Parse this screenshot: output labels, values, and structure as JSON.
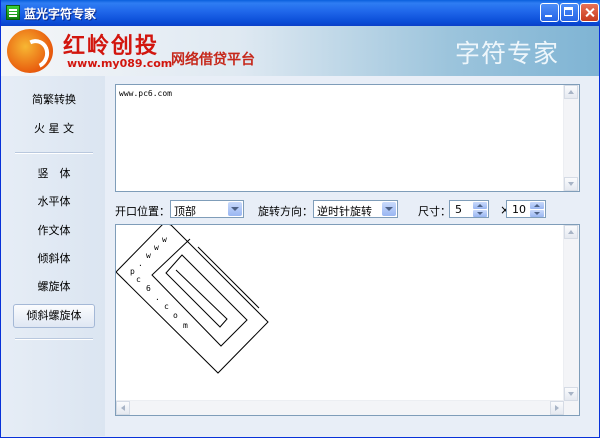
{
  "window": {
    "title": "蓝光字符专家"
  },
  "banner": {
    "brand": "红岭创投",
    "url": "www.my089.com",
    "slogan": "网络借贷平台",
    "product": "字符专家"
  },
  "sidebar": {
    "items": [
      {
        "label": "简繁转换"
      },
      {
        "label": "火 星 文"
      },
      {
        "label": "竖　体"
      },
      {
        "label": "水平体"
      },
      {
        "label": "作文体"
      },
      {
        "label": "倾斜体"
      },
      {
        "label": "螺旋体"
      },
      {
        "label": "倾斜螺旋体",
        "active": true
      }
    ]
  },
  "input": {
    "text": "www.pc6.com"
  },
  "controls": {
    "opening_label": "开口位置：",
    "opening_value": "顶部",
    "rotation_label": "旋转方向：",
    "rotation_value": "逆时针旋转",
    "size_label": "尺寸：",
    "size_rows": "5",
    "size_times": "×",
    "size_cols": "10"
  },
  "output": {
    "characters": [
      "w",
      "w",
      "w",
      ".",
      "p",
      "c",
      "6",
      ".",
      "c",
      "o",
      "m"
    ]
  }
}
